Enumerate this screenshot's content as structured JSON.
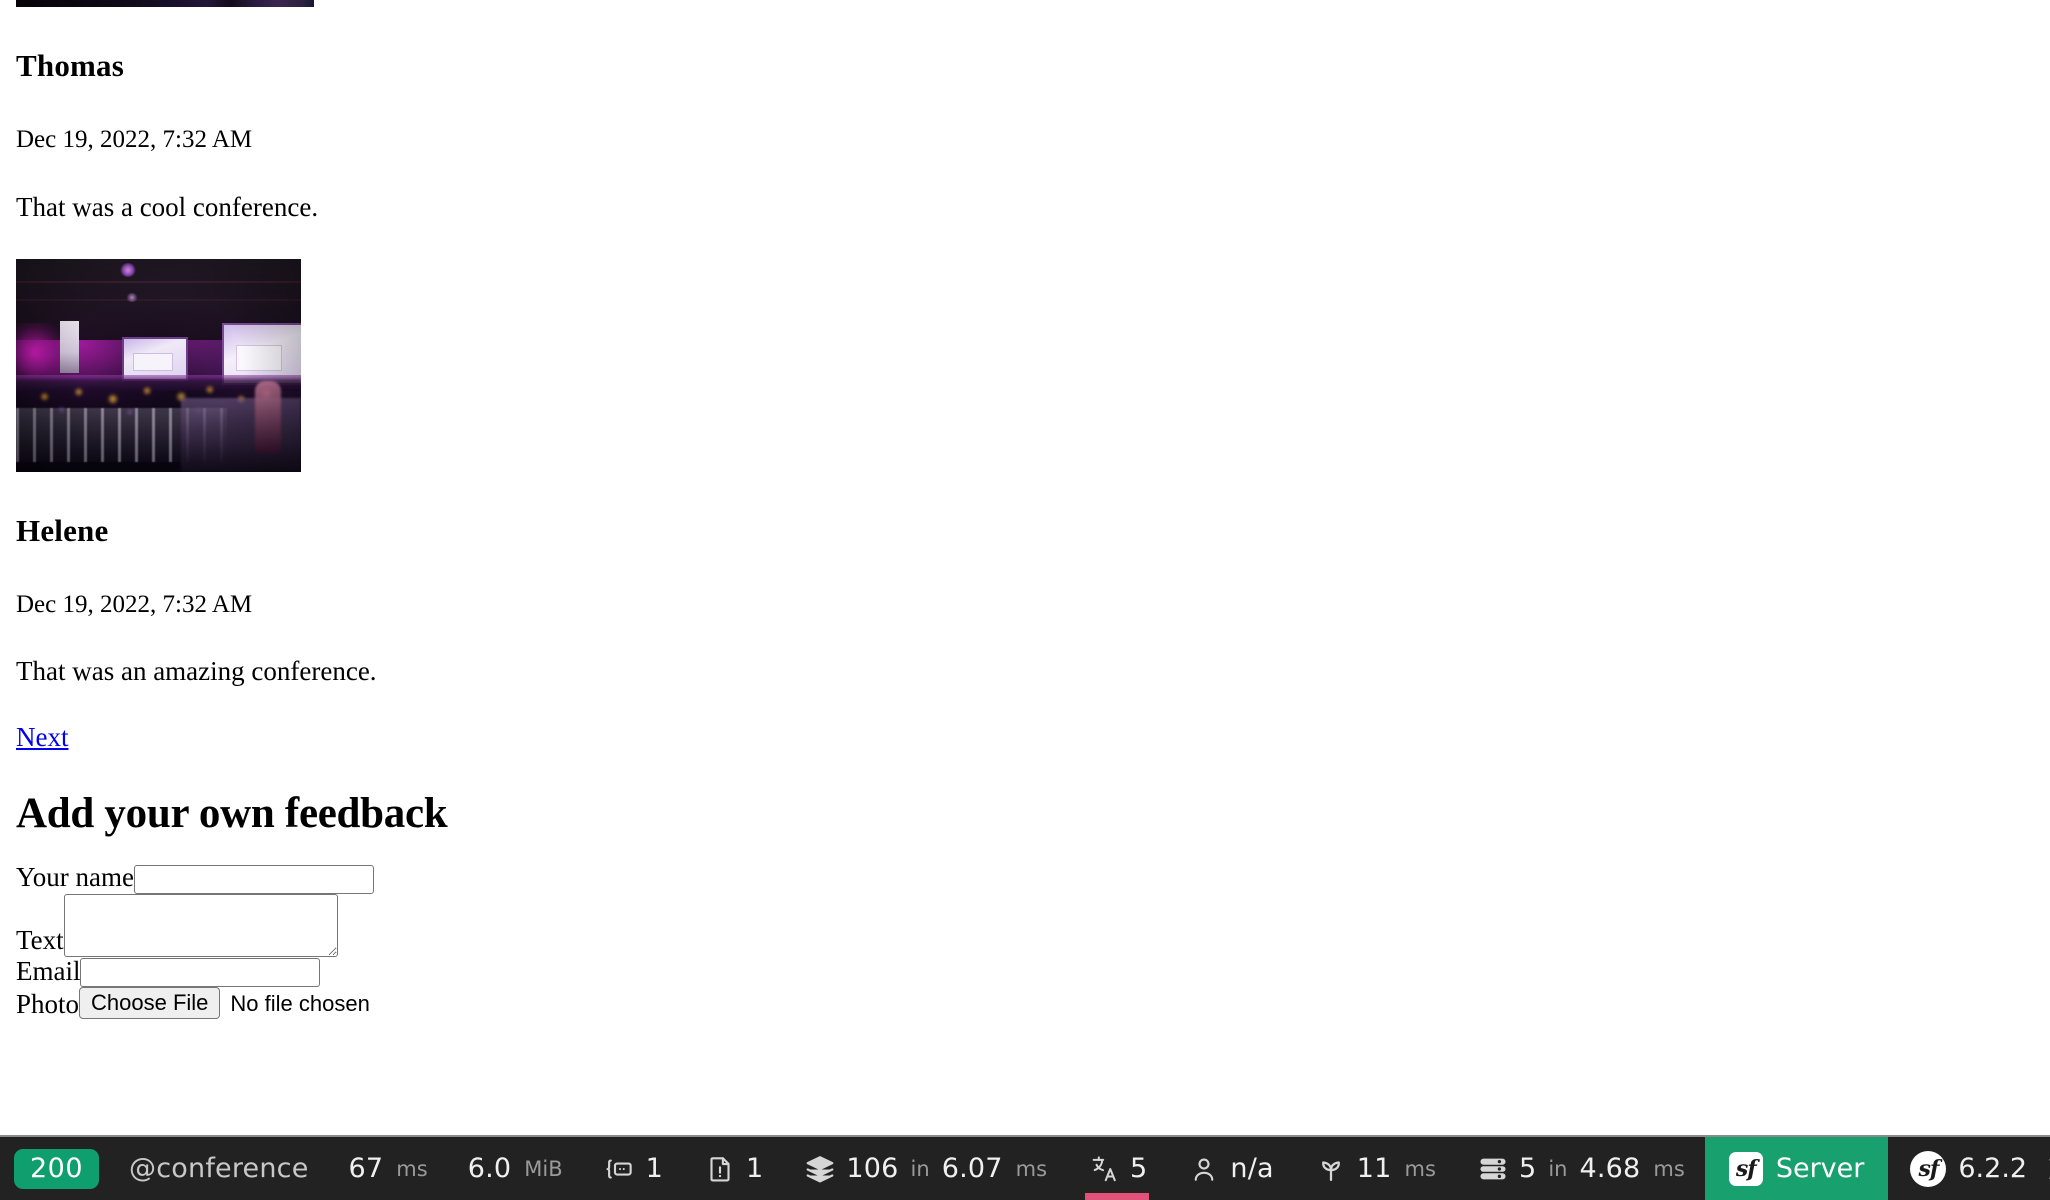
{
  "page": {
    "comments": [
      {
        "author": "Thomas",
        "date": "Dec 19, 2022, 7:32 AM",
        "text": "That was a cool conference.",
        "photo_alt": "conference-hall-photo"
      },
      {
        "author": "Helene",
        "date": "Dec 19, 2022, 7:32 AM",
        "text": "That was an amazing conference."
      }
    ],
    "pagination": {
      "next_label": "Next"
    },
    "form": {
      "heading": "Add your own feedback",
      "fields": {
        "name_label": "Your name",
        "name_value": "",
        "text_label": "Text",
        "text_value": "",
        "email_label": "Email",
        "email_value": "",
        "photo_label": "Photo",
        "photo_button": "Choose File",
        "photo_status": "No file chosen"
      }
    }
  },
  "toolbar": {
    "status_code": "200",
    "route": "@conference",
    "route_prefix": "@",
    "route_name": "conference",
    "time_value": "67",
    "time_unit": "ms",
    "memory_value": "6.0",
    "memory_unit": "MiB",
    "forms_count": "1",
    "logs_count": "1",
    "twig_count": "106",
    "twig_joiner": "in",
    "twig_time": "6.07",
    "twig_unit": "ms",
    "translations_count": "5",
    "security_value": "n/a",
    "cache_value": "11",
    "cache_unit": "ms",
    "db_count": "5",
    "db_joiner": "in",
    "db_time": "4.68",
    "db_unit": "ms",
    "server_label": "Server",
    "version": "6.2.2",
    "close_label": "×",
    "colors": {
      "status_green": "#0f9e6e",
      "server_green": "#18a06e",
      "alert_pink": "#e1527b",
      "background": "#222222"
    }
  }
}
